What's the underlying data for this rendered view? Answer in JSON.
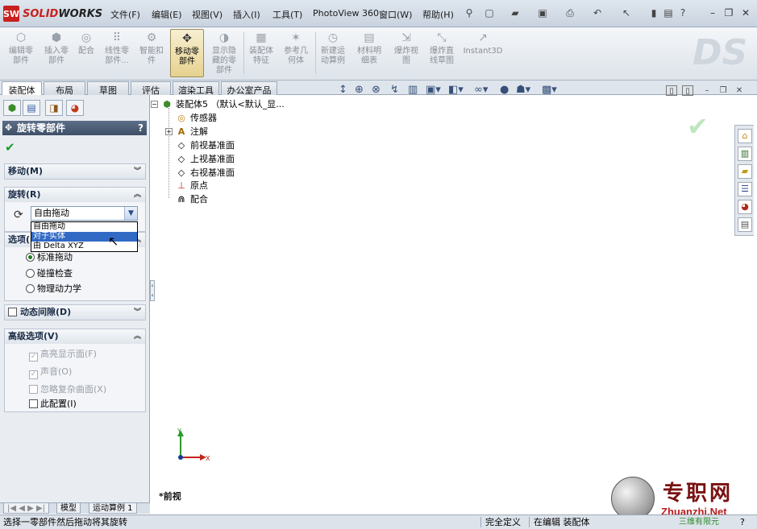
{
  "app": {
    "logo_badge": "SW",
    "logo_text_a": "SOLID",
    "logo_text_b": "WORKS"
  },
  "menu": [
    "文件(F)",
    "编辑(E)",
    "视图(V)",
    "插入(I)",
    "工具(T)",
    "PhotoView 360",
    "窗口(W)",
    "帮助(H)"
  ],
  "commands": [
    {
      "label": "编辑零\n部件",
      "icon": "edit-component-icon"
    },
    {
      "label": "插入零\n部件",
      "icon": "insert-component-icon"
    },
    {
      "label": "配合",
      "icon": "mate-icon"
    },
    {
      "label": "线性零\n部件...",
      "icon": "linear-pattern-icon"
    },
    {
      "label": "智能扣\n件",
      "icon": "smart-fasteners-icon"
    },
    {
      "label": "移动零\n部件",
      "icon": "move-component-icon"
    },
    {
      "label": "显示隐\n藏的零\n部件",
      "icon": "show-hidden-icon"
    },
    {
      "label": "装配体\n特征",
      "icon": "assembly-feature-icon"
    },
    {
      "label": "参考几\n何体",
      "icon": "reference-geometry-icon"
    },
    {
      "label": "新建运\n动算例",
      "icon": "new-motion-study-icon"
    },
    {
      "label": "材料明\n细表",
      "icon": "bom-icon"
    },
    {
      "label": "爆炸视\n图",
      "icon": "exploded-view-icon"
    },
    {
      "label": "爆炸直\n线草图",
      "icon": "explode-line-sketch-icon"
    },
    {
      "label": "Instant3D",
      "icon": "instant3d-icon"
    }
  ],
  "tabs": [
    "装配体",
    "布局",
    "草图",
    "评估",
    "渲染工具",
    "办公室产品"
  ],
  "property_manager": {
    "title": "旋转零部件",
    "help": "?",
    "ok": "✔",
    "groups": {
      "move": "移动(M)",
      "rotate": "旋转(R)",
      "options": "选项(",
      "dynamic_clearance": "动态间隙(D)",
      "advanced": "高级选项(V)"
    },
    "rotate_combo_value": "自由拖动",
    "rotate_options": [
      "自由拖动",
      "对于实体",
      "由 Delta XYZ"
    ],
    "rotate_selected_index": 1,
    "option_radios": [
      {
        "label": "标准拖动",
        "checked": true
      },
      {
        "label": "碰撞检查",
        "checked": false
      },
      {
        "label": "物理动力学",
        "checked": false
      }
    ],
    "advanced_checks": [
      {
        "label": "高亮显示面(F)",
        "checked": true,
        "disabled": true
      },
      {
        "label": "声音(O)",
        "checked": true,
        "disabled": true
      },
      {
        "label": "忽略复杂曲面(X)",
        "checked": false,
        "disabled": true
      },
      {
        "label": "此配置(I)",
        "checked": false,
        "disabled": false
      }
    ]
  },
  "bottom_tabs": [
    "模型",
    "运动算例 1"
  ],
  "tree": {
    "root": "装配体5 （默认<默认_显...",
    "items": [
      {
        "label": "传感器",
        "icon": "sensor-icon"
      },
      {
        "label": "注解",
        "icon": "annotation-icon"
      },
      {
        "label": "前视基准面",
        "icon": "plane-icon"
      },
      {
        "label": "上视基准面",
        "icon": "plane-icon"
      },
      {
        "label": "右视基准面",
        "icon": "plane-icon"
      },
      {
        "label": "原点",
        "icon": "origin-icon"
      },
      {
        "label": "配合",
        "icon": "mates-icon"
      }
    ]
  },
  "view_label": "*前视",
  "triad": {
    "x": "X",
    "y": "Y"
  },
  "status": {
    "message": "选择一零部件然后拖动将其旋转",
    "state": "完全定义",
    "editing": "在编辑 装配体",
    "help": "?"
  },
  "watermark": {
    "title": "专职网",
    "url": "Zhuanzhi.Net",
    "sub": "三维有限元"
  }
}
